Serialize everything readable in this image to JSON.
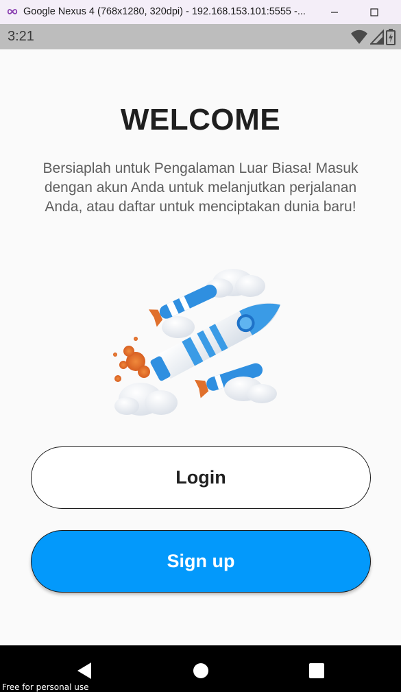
{
  "window": {
    "title": "Google Nexus 4 (768x1280, 320dpi) - 192.168.153.101:5555 -...",
    "app_icon": "infinity-icon",
    "minimize_icon": "minimize-icon",
    "maximize_icon": "maximize-icon"
  },
  "status_bar": {
    "time": "3:21",
    "icons": [
      "wifi-icon",
      "cellular-signal-icon",
      "battery-icon"
    ]
  },
  "content": {
    "title": "WELCOME",
    "description": "Bersiaplah untuk Pengalaman Luar Biasa! Masuk dengan akun Anda untuk melanjutkan perjalanan Anda, atau daftar untuk menciptakan dunia baru!",
    "illustration": "rocket-illustration",
    "login_label": "Login",
    "signup_label": "Sign up"
  },
  "colors": {
    "signup_button": "#0399fb",
    "background": "#fafafa",
    "title_bar": "#f4eef8",
    "status_bar": "#bdbdbd"
  },
  "nav_bar": {
    "icons": [
      "back-icon",
      "home-icon",
      "recents-icon"
    ]
  },
  "watermark": "Free for personal use"
}
